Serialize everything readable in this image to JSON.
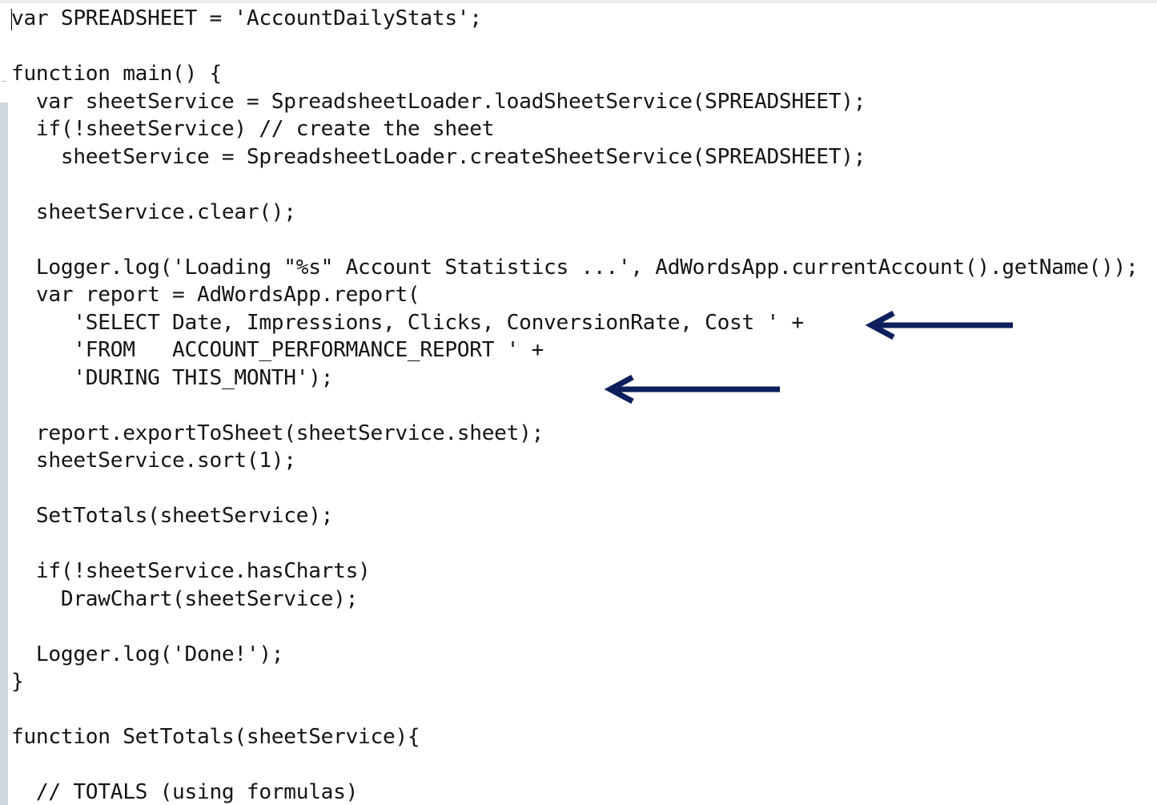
{
  "editor": {
    "lines": [
      "var SPREADSHEET = 'AccountDailyStats';",
      "",
      "function main() {",
      "  var sheetService = SpreadsheetLoader.loadSheetService(SPREADSHEET);",
      "  if(!sheetService) // create the sheet",
      "    sheetService = SpreadsheetLoader.createSheetService(SPREADSHEET);",
      "",
      "  sheetService.clear();",
      "",
      "  Logger.log('Loading \"%s\" Account Statistics ...', AdWordsApp.currentAccount().getName());",
      "  var report = AdWordsApp.report(",
      "     'SELECT Date, Impressions, Clicks, ConversionRate, Cost ' +",
      "     'FROM   ACCOUNT_PERFORMANCE_REPORT ' +",
      "     'DURING THIS_MONTH');",
      "",
      "  report.exportToSheet(sheetService.sheet);",
      "  sheetService.sort(1);",
      "",
      "  SetTotals(sheetService);",
      "",
      "  if(!sheetService.hasCharts)",
      "    DrawChart(sheetService);",
      "",
      "  Logger.log('Done!');",
      "}",
      "",
      "function SetTotals(sheetService){",
      "",
      "  // TOTALS (using formulas)"
    ]
  },
  "annotations": {
    "arrow_color": "#0d1f5c",
    "arrows": [
      {
        "icon": "arrow-left-icon",
        "points_to_line": 12
      },
      {
        "icon": "arrow-left-icon",
        "points_to_line": 14
      }
    ]
  }
}
